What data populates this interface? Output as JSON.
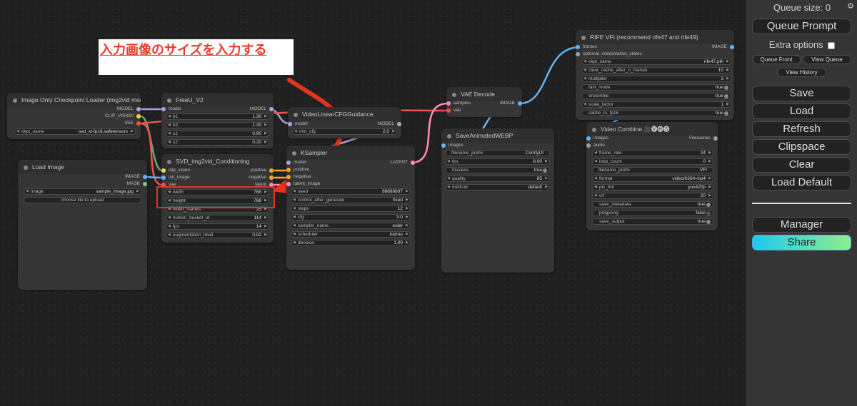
{
  "annotation": {
    "text": "入力画像のサイズを入力する"
  },
  "colors": {
    "model": "#b39ddb",
    "clip": "#ffd54f",
    "vae": "#ef5350",
    "image": "#64b5f6",
    "latent": "#ff8fb6",
    "conditioning": "#ffa726",
    "accent": "#e5331f"
  },
  "nodes": {
    "checkpoint": {
      "title": "Image Only Checkpoint Loader (img2vid model)",
      "outputs": [
        "MODEL",
        "CLIP_VISION",
        "VAE"
      ],
      "ckpt_label": "ckpt_name",
      "ckpt_value": "svd_xt-fp16.safetensors"
    },
    "load_image": {
      "title": "Load Image",
      "outputs": [
        "IMAGE",
        "MASK"
      ],
      "image_label": "image",
      "image_value": "sample_image.jpg",
      "upload_label": "choose file to upload"
    },
    "freeu": {
      "title": "FreeU_V2",
      "input": "model",
      "output": "MODEL",
      "widgets": [
        {
          "label": "b1",
          "value": "1.30"
        },
        {
          "label": "b2",
          "value": "1.40"
        },
        {
          "label": "s1",
          "value": "0.90"
        },
        {
          "label": "s2",
          "value": "0.20"
        }
      ]
    },
    "svd": {
      "title": "SVD_img2vid_Conditioning",
      "inputs": [
        "clip_vision",
        "init_image",
        "vae"
      ],
      "outputs": [
        "positive",
        "negative",
        "latent"
      ],
      "widgets": [
        {
          "label": "width",
          "value": "768"
        },
        {
          "label": "height",
          "value": "768"
        },
        {
          "label": "video_frames",
          "value": "25"
        },
        {
          "label": "motion_bucket_id",
          "value": "114"
        },
        {
          "label": "fps",
          "value": "14"
        },
        {
          "label": "augmentation_level",
          "value": "0.02"
        }
      ]
    },
    "vlcfg": {
      "title": "VideoLinearCFGGuidance",
      "input": "model",
      "output": "MODEL",
      "widgets": [
        {
          "label": "min_cfg",
          "value": "2.0"
        }
      ]
    },
    "ksampler": {
      "title": "KSampler",
      "inputs": [
        "model",
        "positive",
        "negative",
        "latent_image"
      ],
      "output": "LATENT",
      "widgets": [
        {
          "label": "seed",
          "value": "88888887"
        },
        {
          "label": "control_after_generate",
          "value": "fixed"
        },
        {
          "label": "steps",
          "value": "12"
        },
        {
          "label": "cfg",
          "value": "3.0"
        },
        {
          "label": "sampler_name",
          "value": "euler"
        },
        {
          "label": "scheduler",
          "value": "karras"
        },
        {
          "label": "denoise",
          "value": "1.00"
        }
      ]
    },
    "vae_decode": {
      "title": "VAE Decode",
      "inputs": [
        "samples",
        "vae"
      ],
      "output": "IMAGE"
    },
    "save_webp": {
      "title": "SaveAnimatedWEBP",
      "input": "images",
      "widgets": [
        {
          "label": "filename_prefix",
          "value": "ComfyUI",
          "kind": "text"
        },
        {
          "label": "fps",
          "value": "8.00"
        },
        {
          "label": "lossless",
          "value": "true",
          "kind": "toggle"
        },
        {
          "label": "quality",
          "value": "85"
        },
        {
          "label": "method",
          "value": "default"
        }
      ]
    },
    "rife": {
      "title": "RIFE VFI (recommend rife47 and rife49)",
      "inputs": [
        "frames",
        "optional_interpolation_states"
      ],
      "output": "IMAGE",
      "widgets": [
        {
          "label": "ckpt_name",
          "value": "rife47.pth"
        },
        {
          "label": "clear_cache_after_n_frames",
          "value": "10"
        },
        {
          "label": "multiplier",
          "value": "3"
        },
        {
          "label": "fast_mode",
          "value": "true",
          "kind": "toggle"
        },
        {
          "label": "ensemble",
          "value": "true",
          "kind": "toggle"
        },
        {
          "label": "scale_factor",
          "value": "1"
        },
        {
          "label": "cache_in_fp16",
          "value": "true",
          "kind": "toggle"
        }
      ]
    },
    "video_combine": {
      "title": "Video Combine 🎥🅥🅗🅢",
      "inputs": [
        "images",
        "audio"
      ],
      "output": "Filenames",
      "widgets": [
        {
          "label": "frame_rate",
          "value": "24"
        },
        {
          "label": "loop_count",
          "value": "0"
        },
        {
          "label": "filename_prefix",
          "value": "VFI",
          "kind": "text"
        },
        {
          "label": "format",
          "value": "video/h264-mp4"
        },
        {
          "label": "pix_fmt",
          "value": "yuv420p"
        },
        {
          "label": "crf",
          "value": "20"
        },
        {
          "label": "save_metadata",
          "value": "true",
          "kind": "toggle"
        },
        {
          "label": "pingpong",
          "value": "false",
          "kind": "toggle"
        },
        {
          "label": "save_output",
          "value": "true",
          "kind": "toggle"
        }
      ]
    }
  },
  "sidebar": {
    "queue_size": "Queue size: 0",
    "queue_prompt": "Queue Prompt",
    "extra_options": "Extra options",
    "queue_front": "Queue Front",
    "view_queue": "View Queue",
    "view_history": "View History",
    "save": "Save",
    "load": "Load",
    "refresh": "Refresh",
    "clipspace": "Clipspace",
    "clear": "Clear",
    "load_default": "Load Default",
    "manager": "Manager",
    "share": "Share",
    "settings_icon": "gear-icon"
  }
}
